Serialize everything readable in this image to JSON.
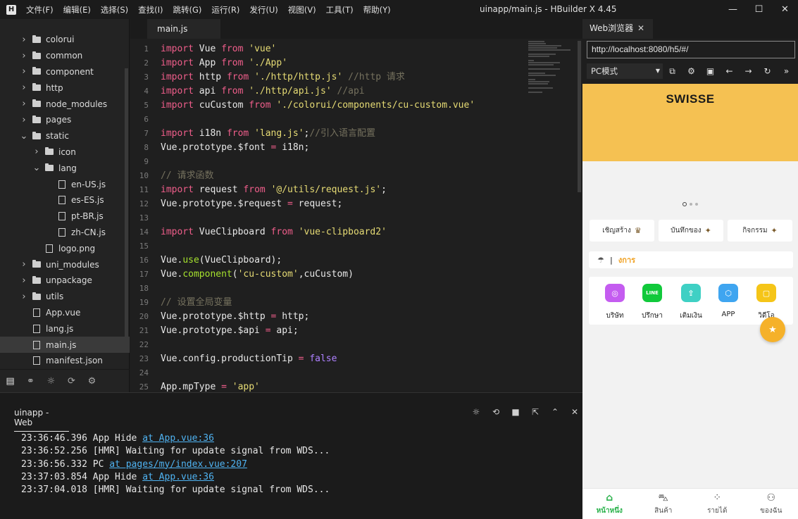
{
  "titlebar": {
    "logo": "H",
    "menu": [
      "文件(F)",
      "编辑(E)",
      "选择(S)",
      "查找(I)",
      "跳转(G)",
      "运行(R)",
      "发行(U)",
      "视图(V)",
      "工具(T)",
      "帮助(Y)"
    ],
    "title": "uinapp/main.js - HBuilder X 4.45",
    "minimize": "—",
    "maximize": "☐",
    "close": "✕"
  },
  "tree": [
    {
      "label": "colorui",
      "kind": "folder",
      "depth": 0,
      "expanded": false
    },
    {
      "label": "common",
      "kind": "folder",
      "depth": 0,
      "expanded": false
    },
    {
      "label": "component",
      "kind": "folder",
      "depth": 0,
      "expanded": false
    },
    {
      "label": "http",
      "kind": "folder",
      "depth": 0,
      "expanded": false
    },
    {
      "label": "node_modules",
      "kind": "folder",
      "depth": 0,
      "expanded": false
    },
    {
      "label": "pages",
      "kind": "folder",
      "depth": 0,
      "expanded": false
    },
    {
      "label": "static",
      "kind": "folder",
      "depth": 0,
      "expanded": true
    },
    {
      "label": "icon",
      "kind": "folder",
      "depth": 1,
      "expanded": false
    },
    {
      "label": "lang",
      "kind": "folder",
      "depth": 1,
      "expanded": true
    },
    {
      "label": "en-US.js",
      "kind": "file",
      "depth": 2
    },
    {
      "label": "es-ES.js",
      "kind": "file",
      "depth": 2
    },
    {
      "label": "pt-BR.js",
      "kind": "file",
      "depth": 2
    },
    {
      "label": "zh-CN.js",
      "kind": "file",
      "depth": 2
    },
    {
      "label": "logo.png",
      "kind": "image",
      "depth": 1
    },
    {
      "label": "uni_modules",
      "kind": "folder",
      "depth": 0,
      "expanded": false
    },
    {
      "label": "unpackage",
      "kind": "folder",
      "depth": 0,
      "expanded": false
    },
    {
      "label": "utils",
      "kind": "folder",
      "depth": 0,
      "expanded": false
    },
    {
      "label": "App.vue",
      "kind": "file",
      "depth": 0
    },
    {
      "label": "lang.js",
      "kind": "file",
      "depth": 0
    },
    {
      "label": "main.js",
      "kind": "file",
      "depth": 0,
      "selected": true
    },
    {
      "label": "manifest.json",
      "kind": "file",
      "depth": 0
    }
  ],
  "editor": {
    "tab": "main.js",
    "lines": [
      [
        [
          "kw",
          "import"
        ],
        [
          "pl",
          " Vue "
        ],
        [
          "kw",
          "from"
        ],
        [
          "pl",
          " "
        ],
        [
          "str",
          "'vue'"
        ]
      ],
      [
        [
          "kw",
          "import"
        ],
        [
          "pl",
          " App "
        ],
        [
          "kw",
          "from"
        ],
        [
          "pl",
          " "
        ],
        [
          "str",
          "'./App'"
        ]
      ],
      [
        [
          "kw",
          "import"
        ],
        [
          "pl",
          " http "
        ],
        [
          "kw",
          "from"
        ],
        [
          "pl",
          " "
        ],
        [
          "str",
          "'./http/http.js'"
        ],
        [
          "pl",
          " "
        ],
        [
          "cm",
          "//http 请求"
        ]
      ],
      [
        [
          "kw",
          "import"
        ],
        [
          "pl",
          " api "
        ],
        [
          "kw",
          "from"
        ],
        [
          "pl",
          " "
        ],
        [
          "str",
          "'./http/api.js'"
        ],
        [
          "pl",
          " "
        ],
        [
          "cm",
          "//api"
        ]
      ],
      [
        [
          "kw",
          "import"
        ],
        [
          "pl",
          " cuCustom "
        ],
        [
          "kw",
          "from"
        ],
        [
          "pl",
          " "
        ],
        [
          "str",
          "'./colorui/components/cu-custom.vue'"
        ]
      ],
      [],
      [
        [
          "kw",
          "import"
        ],
        [
          "pl",
          " i18n "
        ],
        [
          "kw",
          "from"
        ],
        [
          "pl",
          " "
        ],
        [
          "str",
          "'lang.js'"
        ],
        [
          "pl",
          ";"
        ],
        [
          "cm",
          "//引入语言配置"
        ]
      ],
      [
        [
          "pl",
          "Vue.prototype.$font "
        ],
        [
          "op",
          "="
        ],
        [
          "pl",
          " i18n;"
        ]
      ],
      [],
      [
        [
          "cm",
          "// 请求函数"
        ]
      ],
      [
        [
          "kw",
          "import"
        ],
        [
          "pl",
          " request "
        ],
        [
          "kw",
          "from"
        ],
        [
          "pl",
          " "
        ],
        [
          "str",
          "'@/utils/request.js'"
        ],
        [
          "pl",
          ";"
        ]
      ],
      [
        [
          "pl",
          "Vue.prototype.$request "
        ],
        [
          "op",
          "="
        ],
        [
          "pl",
          " request;"
        ]
      ],
      [],
      [
        [
          "kw",
          "import"
        ],
        [
          "pl",
          " VueClipboard "
        ],
        [
          "kw",
          "from"
        ],
        [
          "pl",
          " "
        ],
        [
          "str",
          "'vue-clipboard2'"
        ]
      ],
      [],
      [
        [
          "pl",
          "Vue."
        ],
        [
          "fn",
          "use"
        ],
        [
          "pl",
          "(VueClipboard);"
        ]
      ],
      [
        [
          "pl",
          "Vue."
        ],
        [
          "fn",
          "component"
        ],
        [
          "pl",
          "("
        ],
        [
          "str",
          "'cu-custom'"
        ],
        [
          "pl",
          ",cuCustom)"
        ]
      ],
      [],
      [
        [
          "cm",
          "// 设置全局变量"
        ]
      ],
      [
        [
          "pl",
          "Vue.prototype.$http "
        ],
        [
          "op",
          "="
        ],
        [
          "pl",
          " http;"
        ]
      ],
      [
        [
          "pl",
          "Vue.prototype.$api "
        ],
        [
          "op",
          "="
        ],
        [
          "pl",
          " api;"
        ]
      ],
      [],
      [
        [
          "pl",
          "Vue.config.productionTip "
        ],
        [
          "op",
          "="
        ],
        [
          "pl",
          " "
        ],
        [
          "num",
          "false"
        ]
      ],
      [],
      [
        [
          "pl",
          "App.mpType "
        ],
        [
          "op",
          "="
        ],
        [
          "pl",
          " "
        ],
        [
          "str",
          "'app'"
        ]
      ]
    ]
  },
  "console": {
    "tab": "uinapp - Web",
    "logs": [
      {
        "time": "23:36:46.396",
        "msg": "App Hide ",
        "link": "at App.vue:36"
      },
      {
        "time": "23:36:52.256",
        "msg": "[HMR] Waiting for update signal from WDS...",
        "link": ""
      },
      {
        "time": "23:36:56.332",
        "msg": "PC ",
        "link": "at pages/my/index.vue:207"
      },
      {
        "time": "23:37:03.854",
        "msg": "App Hide ",
        "link": "at App.vue:36"
      },
      {
        "time": "23:37:04.018",
        "msg": "[HMR] Waiting for update signal from WDS...",
        "link": ""
      }
    ]
  },
  "browser": {
    "tab": "Web浏览器",
    "tab_close": "✕",
    "url": "http://localhost:8080/h5/#/",
    "mode": "PC模式"
  },
  "phone": {
    "brand": "SWISSE",
    "quick": [
      {
        "label": "เชิญสร้าง",
        "icon": "♛"
      },
      {
        "label": "บันทึกของ",
        "icon": "✦"
      },
      {
        "label": "กิจกรรม",
        "icon": "✦"
      }
    ],
    "notice": "งการ",
    "grid": [
      {
        "label": "บริษัท",
        "color": "#c45cf0",
        "icon": "◎"
      },
      {
        "label": "ปรึกษา",
        "color": "#11c93b",
        "icon": "LINE"
      },
      {
        "label": "เติมเงิน",
        "color": "#3fd0c4",
        "icon": "⇪"
      },
      {
        "label": "APP",
        "color": "#3fa5f0",
        "icon": "⬡"
      },
      {
        "label": "วิดีโอ",
        "color": "#f5c518",
        "icon": "▢"
      }
    ],
    "nav": [
      {
        "label": "หน้าหนึ่ง",
        "icon": "⌂",
        "active": true
      },
      {
        "label": "สินค้า",
        "icon": "⛍",
        "active": false
      },
      {
        "label": "รายได้",
        "icon": "⁘",
        "active": false
      },
      {
        "label": "ของฉัน",
        "icon": "⚇",
        "active": false
      }
    ]
  }
}
